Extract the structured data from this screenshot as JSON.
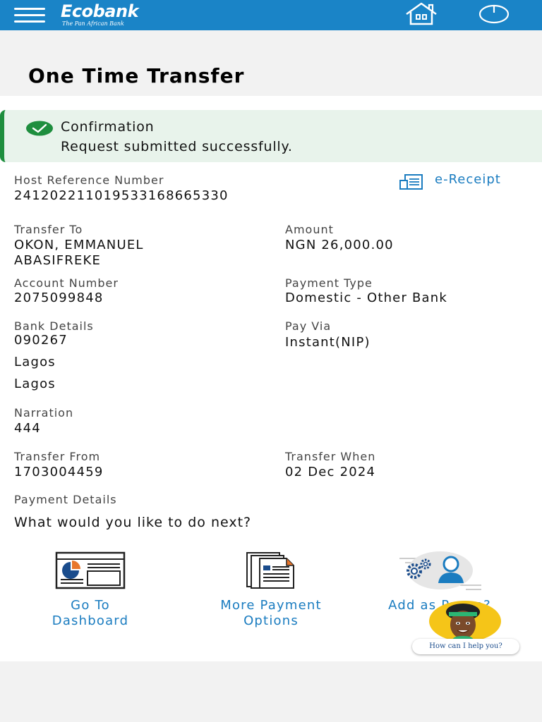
{
  "header": {
    "menu_icon": "hamburger-icon",
    "logo_text": "Ecobank",
    "logo_tagline": "The Pan African Bank",
    "home_icon": "home-icon",
    "power_icon": "power-icon",
    "brand_color": "#1a84c7"
  },
  "page": {
    "title": "One Time Transfer"
  },
  "confirmation": {
    "icon": "check-circle-icon",
    "title": "Confirmation",
    "message": "Request submitted successfully.",
    "accent_color": "#1e8e3e"
  },
  "details": {
    "host_ref_label": "Host Reference Number",
    "host_ref_value": "24120221101953316866533​0",
    "ereceipt_label": "e-Receipt",
    "transfer_to_label": "Transfer To",
    "transfer_to_line1": "OKON, EMMANUEL",
    "transfer_to_line2": "ABASIFREKE",
    "amount_label": "Amount",
    "amount_value": "NGN 26,000.00",
    "account_number_label": "Account Number",
    "account_number_value": "2075099848",
    "payment_type_label": "Payment Type",
    "payment_type_value": "Domestic - Other Bank",
    "bank_details_label": "Bank Details",
    "bank_details_line1": "090267",
    "bank_details_line2": "Lagos",
    "bank_details_line3": "Lagos",
    "pay_via_label": "Pay Via",
    "pay_via_value": "Instant(NIP)",
    "narration_label": "Narration",
    "narration_value": "444",
    "transfer_from_label": "Transfer From",
    "transfer_from_value": "1703004459",
    "transfer_when_label": "Transfer When",
    "transfer_when_value": "02 Dec 2024",
    "payment_details_label": "Payment Details"
  },
  "next": {
    "question": "What would you like to do next?",
    "actions": [
      {
        "line1": "Go To",
        "line2": "Dashboard",
        "icon": "dashboard-icon"
      },
      {
        "line1": "More Payment",
        "line2": "Options",
        "icon": "documents-icon"
      },
      {
        "line1": "Add as Payee?",
        "icon": "add-payee-icon"
      }
    ]
  },
  "chat": {
    "prompt": "How can I help you?",
    "icon": "assistant-avatar-icon"
  }
}
